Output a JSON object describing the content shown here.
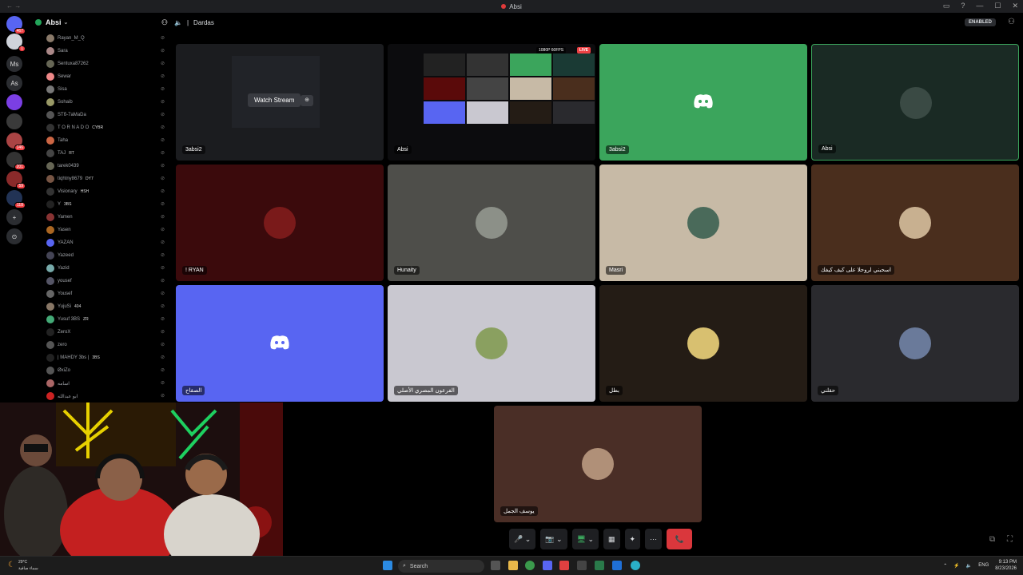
{
  "window": {
    "title": "Absi",
    "controls": [
      "▭",
      "?",
      "—",
      "☐",
      "✕"
    ]
  },
  "rail": {
    "servers": [
      {
        "label": "",
        "badge": "467",
        "color": "#5865f2"
      },
      {
        "label": "",
        "badge": "1",
        "color": "#cfd3da"
      },
      {
        "label": "Ms",
        "badge": "",
        "color": "#2b2d31"
      },
      {
        "label": "As",
        "badge": "",
        "color": "#2b2d31"
      },
      {
        "label": "",
        "badge": "",
        "color": "#7b3fe4"
      },
      {
        "label": "",
        "badge": "",
        "color": "#3a3a3a"
      },
      {
        "label": "",
        "badge": "146",
        "color": "#a44"
      },
      {
        "label": "",
        "badge": "201",
        "color": "#333"
      },
      {
        "label": "",
        "badge": "59",
        "color": "#8a2a2a"
      },
      {
        "label": "",
        "badge": "118",
        "color": "#235"
      },
      {
        "label": "+",
        "badge": "",
        "color": "#2b2d31"
      },
      {
        "label": "⊙",
        "badge": "",
        "color": "#2b2d31"
      }
    ]
  },
  "sidebar": {
    "server_name": "Absi",
    "members": [
      {
        "name": "Rayan_M_Q",
        "tag": "",
        "color": "#8a7a6a"
      },
      {
        "name": "Sara",
        "tag": "",
        "color": "#a88"
      },
      {
        "name": "Sentuxa87262",
        "tag": "",
        "color": "#665"
      },
      {
        "name": "Sewar",
        "tag": "",
        "color": "#e88"
      },
      {
        "name": "Sisa",
        "tag": "",
        "color": "#777"
      },
      {
        "name": "Sohaib",
        "tag": "",
        "color": "#996"
      },
      {
        "name": "STб-7aMaDa",
        "tag": "",
        "color": "#555"
      },
      {
        "name": "T O R N A D O",
        "tag": "CYBR",
        "color": "#333"
      },
      {
        "name": "Taha",
        "tag": "",
        "color": "#c64"
      },
      {
        "name": "TAJ",
        "tag": "RT",
        "color": "#444"
      },
      {
        "name": "tarek0439",
        "tag": "",
        "color": "#665"
      },
      {
        "name": "tiqhtny8679",
        "tag": "DY7",
        "color": "#754"
      },
      {
        "name": "Visionary",
        "tag": "HSH",
        "color": "#333"
      },
      {
        "name": "Y",
        "tag": "3BS",
        "color": "#222"
      },
      {
        "name": "Yamen",
        "tag": "",
        "color": "#833"
      },
      {
        "name": "Yasen",
        "tag": "",
        "color": "#a62"
      },
      {
        "name": "YAZAN",
        "tag": "",
        "color": "#5865f2"
      },
      {
        "name": "Yazeed",
        "tag": "",
        "color": "#445"
      },
      {
        "name": "Yazid",
        "tag": "",
        "color": "#7aa"
      },
      {
        "name": "yousef",
        "tag": "",
        "color": "#556"
      },
      {
        "name": "Yousef",
        "tag": "",
        "color": "#666"
      },
      {
        "name": "YujuSi",
        "tag": "404",
        "color": "#876"
      },
      {
        "name": "Yusuf 3BS",
        "tag": "ZR",
        "color": "#4a7"
      },
      {
        "name": "ZeroX",
        "tag": "",
        "color": "#222"
      },
      {
        "name": "zero",
        "tag": "",
        "color": "#555"
      },
      {
        "name": "| MAHDY 3bs |",
        "tag": "3BS",
        "color": "#222"
      },
      {
        "name": "ØxiZo",
        "tag": "",
        "color": "#555"
      },
      {
        "name": "اسامه",
        "tag": "",
        "color": "#a66"
      },
      {
        "name": "ابو عبدالله",
        "tag": "",
        "color": "#c22"
      }
    ]
  },
  "voice": {
    "channel": "Dardas",
    "status": "ENABLED"
  },
  "tiles": [
    {
      "label": "3absi2",
      "bg": "#1b1c1f",
      "kind": "stream",
      "button": "Watch Stream"
    },
    {
      "label": "Absi",
      "bg": "#0c0c0e",
      "kind": "live",
      "live": "LIVE",
      "quality": "1080P 60FPS"
    },
    {
      "label": "3absi2",
      "bg": "#3ba55c",
      "kind": "discord"
    },
    {
      "label": "Absi",
      "bg": "#1a2a24",
      "kind": "avatar",
      "avatar": "#3a4a44"
    },
    {
      "label": "! RYAN",
      "bg": "#3b0a0c",
      "kind": "avatar",
      "avatar": "#7a1a1a"
    },
    {
      "label": "Hunaity",
      "bg": "#4e4e4a",
      "kind": "avatar",
      "avatar": "#8c9088"
    },
    {
      "label": "Masri",
      "bg": "#c7baa6",
      "kind": "avatar",
      "avatar": "#4a6a5a"
    },
    {
      "label": "اسحبني لروحلا على كيف كيفك",
      "bg": "#4a2e1d",
      "kind": "avatar",
      "avatar": "#c8b090"
    },
    {
      "label": "الصقاح",
      "bg": "#5865f2",
      "kind": "discord"
    },
    {
      "label": "الفرعون المصري الأصلي",
      "bg": "#c9c8d0",
      "kind": "avatar",
      "avatar": "#8aa060"
    },
    {
      "label": "بطل",
      "bg": "#241c15",
      "kind": "avatar",
      "avatar": "#d8c070"
    },
    {
      "label": "حقلني",
      "bg": "#2a2a2e",
      "kind": "avatar",
      "avatar": "#6a7a9a"
    },
    {
      "label": "يوسف الجمل",
      "bg": "#4a2e26",
      "kind": "avatar",
      "avatar": "#b09078"
    }
  ],
  "controls": {
    "mic": "🎤",
    "camera": "📷",
    "screen": "🖥",
    "activity": "▦",
    "soundboard": "✦",
    "more": "···",
    "end": "📞"
  },
  "taskbar": {
    "search": "Search",
    "weather_temp": "29°C",
    "weather_desc": "سماء صافية",
    "lang": "ENG",
    "time": "9:13 PM",
    "date": "8/23/2026"
  }
}
